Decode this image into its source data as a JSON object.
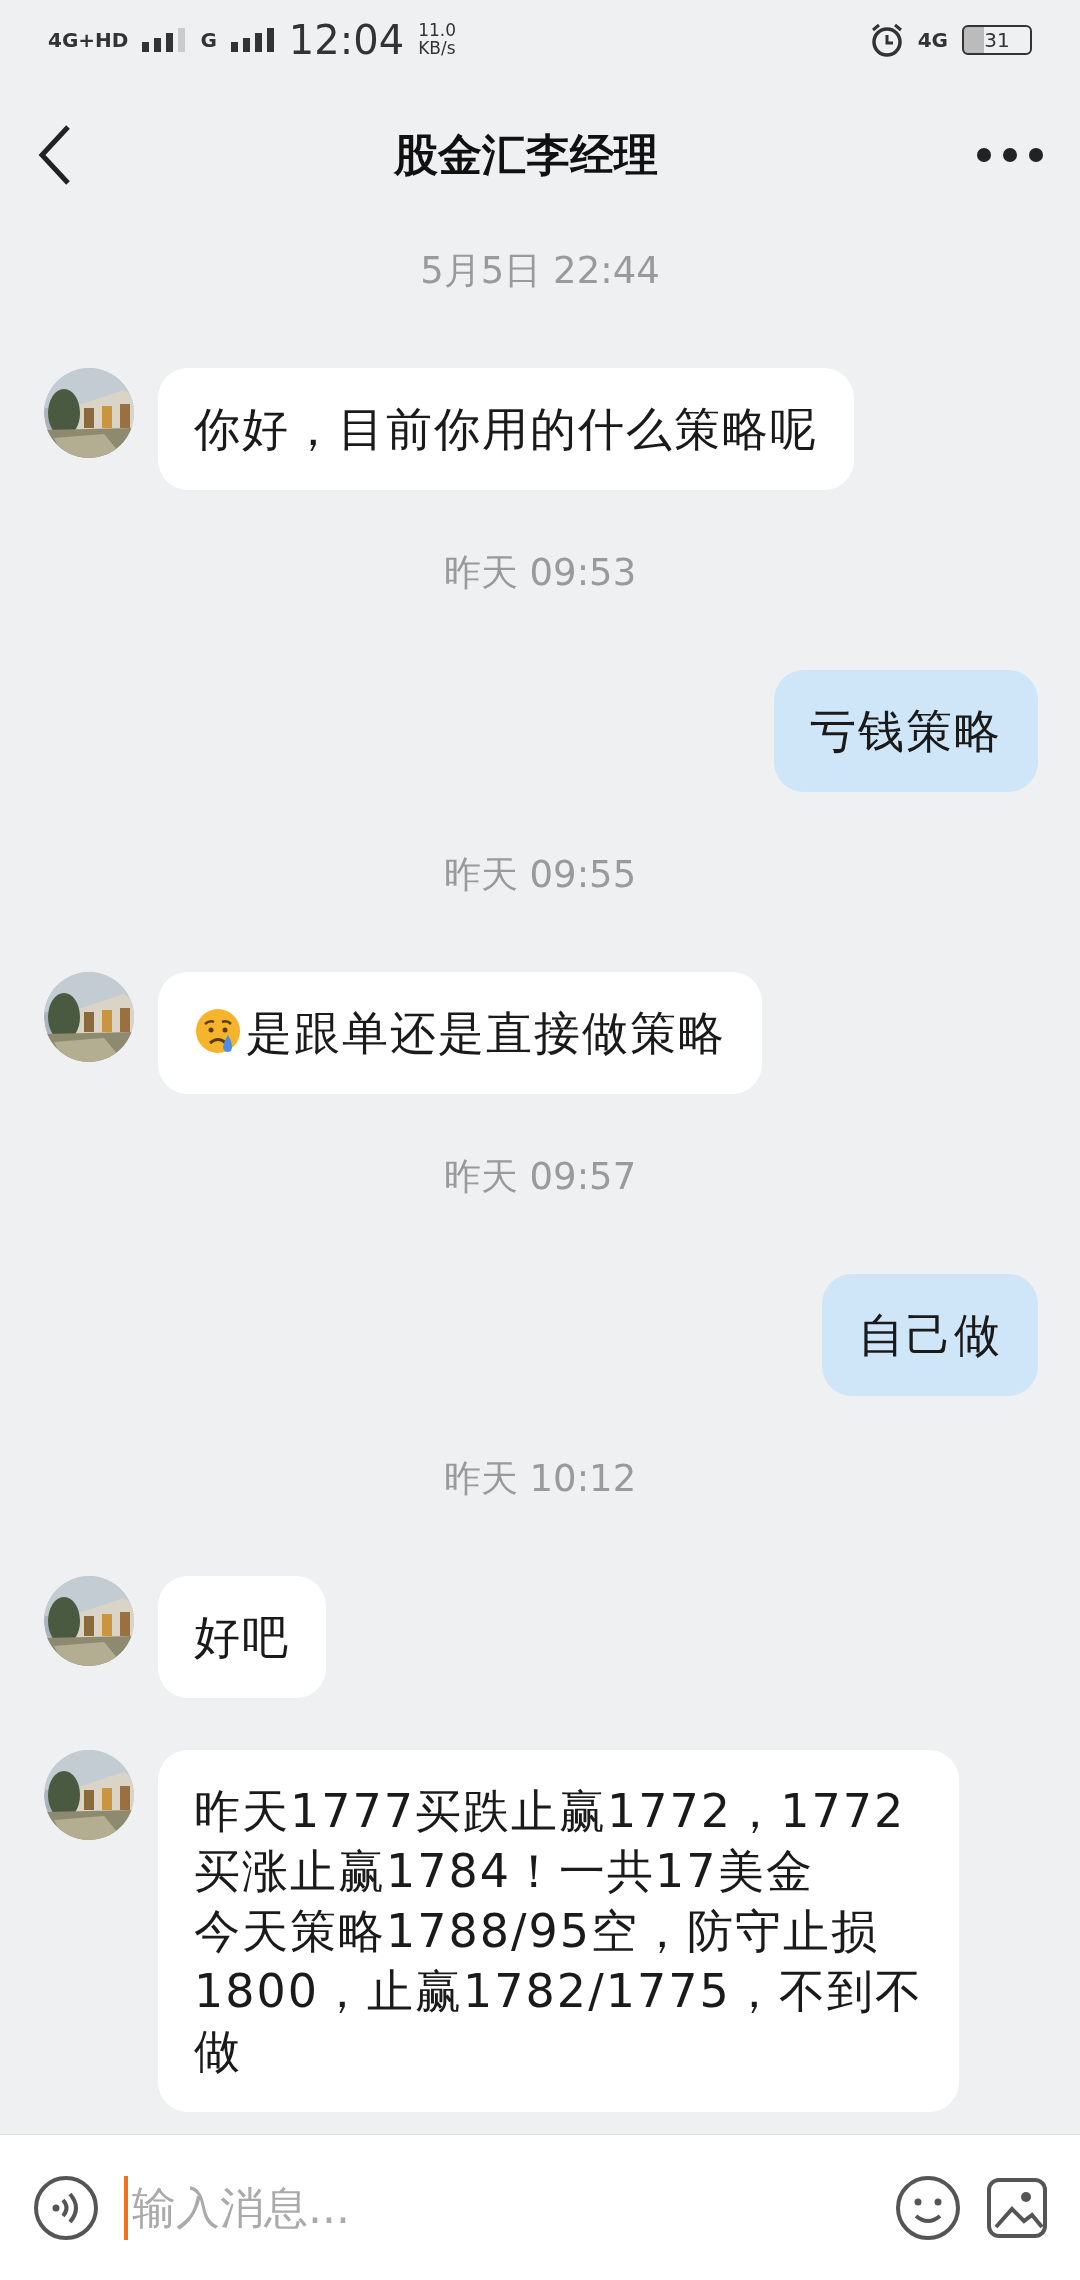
{
  "status_bar": {
    "network_primary": "4G+HD",
    "network_secondary": "G",
    "time": "12:04",
    "speed_value": "11.0",
    "speed_unit": "KB/s",
    "network_right": "4G",
    "battery": "31"
  },
  "header": {
    "title": "股金汇李经理"
  },
  "messages": [
    {
      "kind": "time",
      "text": "5月5日 22:44"
    },
    {
      "kind": "message",
      "outgoing": false,
      "emoji_prefix": false,
      "lines": [
        "你好，目前你用的什么策略呢"
      ]
    },
    {
      "kind": "time",
      "text": "昨天 09:53"
    },
    {
      "kind": "message",
      "outgoing": true,
      "emoji_prefix": false,
      "lines": [
        "亏钱策略"
      ]
    },
    {
      "kind": "time",
      "text": "昨天 09:55"
    },
    {
      "kind": "message",
      "outgoing": false,
      "emoji_prefix": true,
      "lines": [
        "是跟单还是直接做策略"
      ]
    },
    {
      "kind": "time",
      "text": "昨天 09:57"
    },
    {
      "kind": "message",
      "outgoing": true,
      "emoji_prefix": false,
      "lines": [
        "自己做"
      ]
    },
    {
      "kind": "time",
      "text": "昨天 10:12"
    },
    {
      "kind": "message",
      "outgoing": false,
      "emoji_prefix": false,
      "lines": [
        "好吧"
      ]
    },
    {
      "kind": "message",
      "outgoing": false,
      "emoji_prefix": false,
      "lines": [
        "昨天1777买跌止赢1772，1772",
        "买涨止赢1784！一共17美金",
        "今天策略1788/95空，防守止损",
        "1800，止赢1782/1775，不到不",
        "做"
      ]
    }
  ],
  "composer": {
    "placeholder": "输入消息..."
  }
}
